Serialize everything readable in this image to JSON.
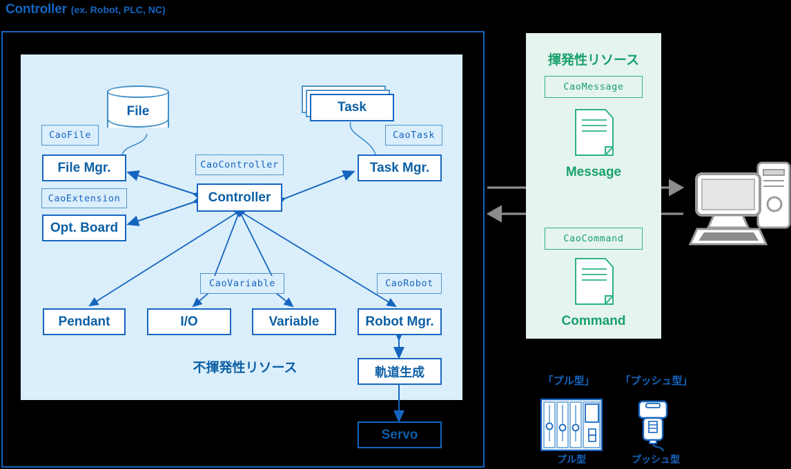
{
  "header": {
    "title": "Controller",
    "subtitle": "(ex. Robot, PLC, NC)"
  },
  "colors": {
    "blue_accent": "#1565C0",
    "blue_text": "#0B5FA5",
    "panel_blue": "#DBEEFB",
    "green_accent": "#17A06E",
    "green_border": "#2BB283",
    "panel_green": "#E6F4EE",
    "gray_arrow": "#8C8C8C"
  },
  "nonvolatile": {
    "label": "不揮発性リソース",
    "nodes": {
      "file": "File",
      "file_mgr": "File Mgr.",
      "opt_board": "Opt. Board",
      "controller": "Controller",
      "task": "Task",
      "task_mgr": "Task Mgr.",
      "pendant": "Pendant",
      "io": "I/O",
      "variable": "Variable",
      "robot_mgr": "Robot Mgr.",
      "trajectory": "軌道生成",
      "servo": "Servo"
    },
    "interfaces": {
      "cao_file": "CaoFile",
      "cao_extension": "CaoExtension",
      "cao_controller": "CaoController",
      "cao_task": "CaoTask",
      "cao_variable": "CaoVariable",
      "cao_robot": "CaoRobot"
    }
  },
  "volatile": {
    "title": "揮発性リソース",
    "items": [
      {
        "interface": "CaoMessage",
        "caption": "Message",
        "icon": "document-icon"
      },
      {
        "interface": "CaoCommand",
        "caption": "Command",
        "icon": "document-icon"
      }
    ]
  },
  "device": {
    "icon": "desktop-computer-icon"
  },
  "legend": [
    {
      "title": "「プル型」",
      "caption": "プル型",
      "icon": "plc-rack-icon"
    },
    {
      "title": "「プッシュ型」",
      "caption": "プッシュ型",
      "icon": "handheld-scanner-icon"
    }
  ]
}
